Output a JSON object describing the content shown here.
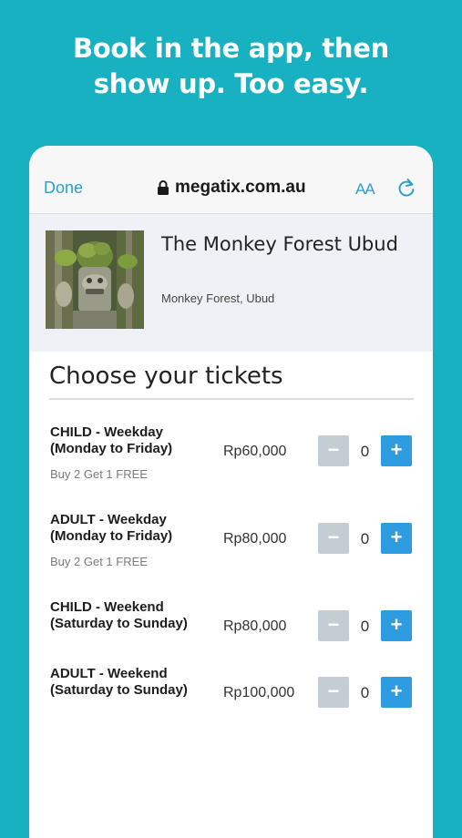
{
  "headline": {
    "line1": "Book in the app, then",
    "line2": "show up. Too easy."
  },
  "browser": {
    "done_label": "Done",
    "url": "megatix.com.au",
    "text_size_label": "AA",
    "icons": [
      "lock-icon",
      "text-size-icon",
      "reload-icon"
    ]
  },
  "event": {
    "title": "The Monkey Forest Ubud",
    "location": "Monkey Forest, Ubud"
  },
  "tickets": {
    "heading": "Choose your tickets",
    "items": [
      {
        "name_line1": "CHILD - Weekday",
        "name_line2": "(Monday to Friday)",
        "promo": "Buy 2 Get 1 FREE",
        "price": "Rp60,000",
        "qty": "0",
        "minus": "−",
        "plus": "+"
      },
      {
        "name_line1": "ADULT - Weekday",
        "name_line2": "(Monday to Friday)",
        "promo": "Buy 2 Get 1 FREE",
        "price": "Rp80,000",
        "qty": "0",
        "minus": "−",
        "plus": "+"
      },
      {
        "name_line1": "CHILD - Weekend",
        "name_line2": "(Saturday to Sunday)",
        "promo": "",
        "price": "Rp80,000",
        "qty": "0",
        "minus": "−",
        "plus": "+"
      },
      {
        "name_line1": "ADULT - Weekend",
        "name_line2": "(Saturday to Sunday)",
        "promo": "",
        "price": "Rp100,000",
        "qty": "0",
        "minus": "−",
        "plus": "+"
      }
    ]
  },
  "colors": {
    "background": "#17b1c2",
    "accent": "#2e9ce0",
    "link": "#2d9fc8",
    "minus_button": "#c5cdd4"
  }
}
